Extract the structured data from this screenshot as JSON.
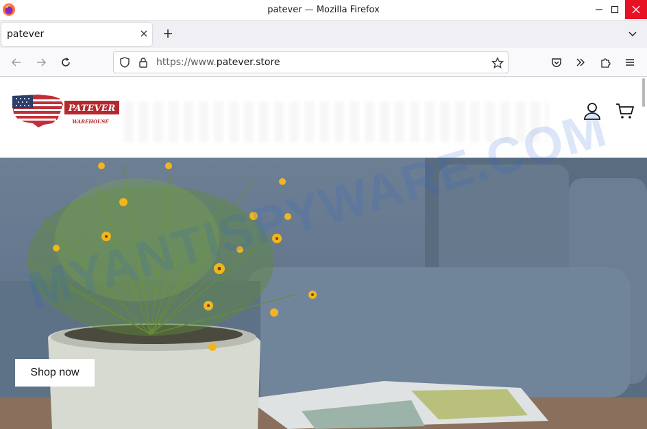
{
  "browser": {
    "window_title": "patever — Mozilla Firefox",
    "tab": {
      "title": "patever"
    },
    "url": {
      "scheme": "https://www.",
      "host": "patever.store"
    },
    "icons": [
      "firefox-logo",
      "close-icon",
      "new-tab-icon",
      "chevron-down-icon",
      "back-icon",
      "forward-icon",
      "reload-icon",
      "shield-icon",
      "lock-icon",
      "bookmark-star-icon",
      "pocket-icon",
      "overflow-icon",
      "extensions-icon",
      "menu-icon"
    ]
  },
  "site": {
    "logo": {
      "brand": "PATEVER",
      "tagline": "WAREHOUSE"
    },
    "header_icons": [
      "account-icon",
      "cart-icon"
    ],
    "hero": {
      "cta": "Shop now"
    }
  },
  "watermark": "MYANTISPYWARE.COM",
  "colors": {
    "close_button": "#e81123",
    "logo_red": "#b5282d",
    "logo_blue": "#2c3e6b",
    "hero_background": "#667990"
  }
}
